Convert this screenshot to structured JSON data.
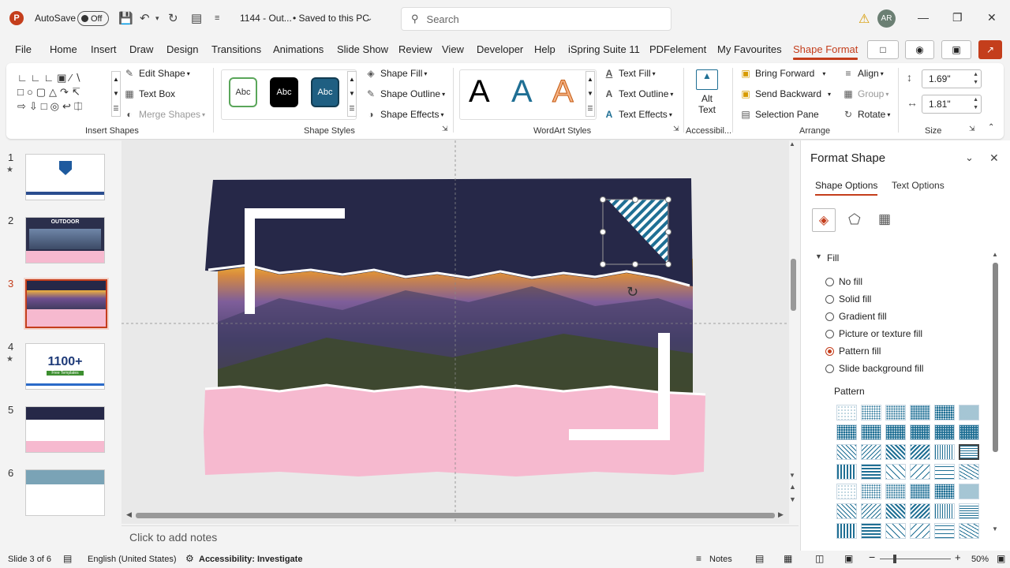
{
  "titlebar": {
    "autosave_label": "AutoSave",
    "autosave_state": "Off",
    "doc_title": "1144 - Out...",
    "saved_status": "• Saved to this PC",
    "search_placeholder": "Search",
    "avatar_initials": "AR"
  },
  "tabs": [
    "File",
    "Home",
    "Insert",
    "Draw",
    "Design",
    "Transitions",
    "Animations",
    "Slide Show",
    "Review",
    "View",
    "Developer",
    "Help",
    "iSpring Suite 11",
    "PDFelement",
    "My Favourites",
    "Shape Format"
  ],
  "active_tab": "Shape Format",
  "ribbon": {
    "insert_shapes": {
      "label": "Insert Shapes",
      "edit_shape": "Edit Shape",
      "text_box": "Text Box",
      "merge_shapes": "Merge Shapes"
    },
    "shape_styles": {
      "label": "Shape Styles",
      "presets": [
        "Abc",
        "Abc",
        "Abc"
      ],
      "shape_fill": "Shape Fill",
      "shape_outline": "Shape Outline",
      "shape_effects": "Shape Effects"
    },
    "wordart": {
      "label": "WordArt Styles",
      "letters": [
        "A",
        "A",
        "A"
      ],
      "text_fill": "Text Fill",
      "text_outline": "Text Outline",
      "text_effects": "Text Effects"
    },
    "accessibility": {
      "label": "Accessibil...",
      "alt_text_line1": "Alt",
      "alt_text_line2": "Text"
    },
    "arrange": {
      "label": "Arrange",
      "bring_forward": "Bring Forward",
      "send_backward": "Send Backward",
      "selection_pane": "Selection Pane",
      "align": "Align",
      "group": "Group",
      "rotate": "Rotate"
    },
    "size": {
      "label": "Size",
      "height": "1.69\"",
      "width": "1.81\""
    }
  },
  "slides": [
    {
      "num": "1",
      "star": true
    },
    {
      "num": "2",
      "star": false,
      "title": "OUTDOOR"
    },
    {
      "num": "3",
      "star": false,
      "active": true
    },
    {
      "num": "4",
      "star": true,
      "title": "1100+",
      "subtitle": "Free Templates"
    },
    {
      "num": "5",
      "star": false
    },
    {
      "num": "6",
      "star": false
    }
  ],
  "notes_placeholder": "Click to add notes",
  "format_pane": {
    "title": "Format Shape",
    "tab_shape": "Shape Options",
    "tab_text": "Text Options",
    "section": "Fill",
    "options": [
      "No fill",
      "Solid fill",
      "Gradient fill",
      "Picture or texture fill",
      "Pattern fill",
      "Slide background fill"
    ],
    "selected_option": "Pattern fill",
    "pattern_label": "Pattern"
  },
  "status": {
    "slide_info": "Slide 3 of 6",
    "language": "English (United States)",
    "accessibility": "Accessibility: Investigate",
    "notes": "Notes",
    "zoom": "50%"
  },
  "colors": {
    "accent": "#c43e1c",
    "slide_navy": "#262848",
    "slide_pink": "#f6b9cf",
    "pattern_blue": "#1f6f94"
  }
}
